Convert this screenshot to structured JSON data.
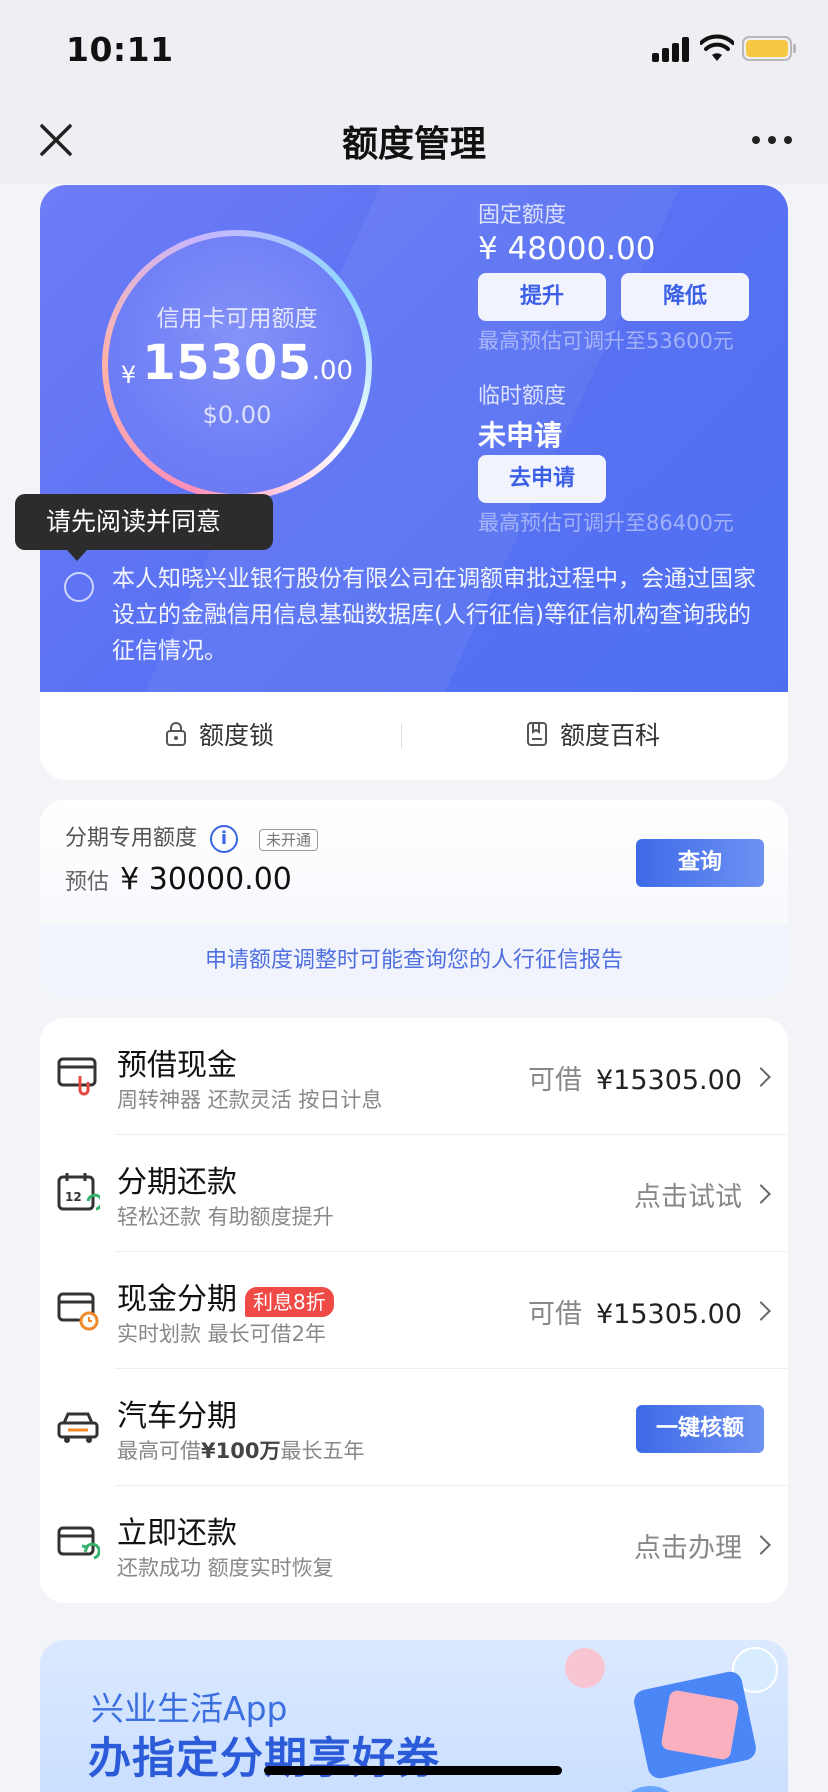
{
  "status_bar": {
    "time": "10:11"
  },
  "nav": {
    "title": "额度管理"
  },
  "hero": {
    "ring_label": "信用卡可用额度",
    "currency": "¥",
    "available_int": "15305",
    "available_dec": ".00",
    "available_secondary": "$0.00",
    "fixed_label": "固定额度",
    "fixed_amount": "¥ 48000.00",
    "raise_btn": "提升",
    "lower_btn": "降低",
    "fixed_hint": "最高预估可调升至53600元",
    "temp_label": "临时额度",
    "temp_status": "未申请",
    "apply_btn": "去申请",
    "temp_hint": "最高预估可调升至86400元",
    "agreement": "本人知晓兴业银行股份有限公司在调额审批过程中，会通过国家设立的金融信用信息基础数据库(人行征信)等征信机构查询我的征信情况。",
    "tooltip": "请先阅读并同意"
  },
  "tabs": [
    {
      "label": "额度锁",
      "icon": "lock-icon"
    },
    {
      "label": "额度百科",
      "icon": "book-icon"
    }
  ],
  "installment": {
    "label": "分期专用额度",
    "status_tag": "未开通",
    "estimate_prefix": "预估",
    "amount": "¥ 30000.00",
    "query_btn": "查询",
    "notice": "申请额度调整时可能查询您的人行征信报告"
  },
  "list": [
    {
      "title": "预借现金",
      "subtitle": "周转神器 还款灵活 按日计息",
      "right_label": "可借",
      "right_value": "¥15305.00",
      "icon": "cash-advance-icon"
    },
    {
      "title": "分期还款",
      "subtitle": "轻松还款 有助额度提升",
      "right_label": "点击试试",
      "icon": "calendar-installment-icon"
    },
    {
      "title": "现金分期",
      "badge": "利息8折",
      "subtitle": "实时划款 最长可借2年",
      "right_label": "可借",
      "right_value": "¥15305.00",
      "icon": "cash-installment-icon"
    },
    {
      "title": "汽车分期",
      "subtitle_pre": "最高可借",
      "subtitle_bold": "¥100万",
      "subtitle_post": "最长五年",
      "button": "一键核额",
      "icon": "car-icon"
    },
    {
      "title": "立即还款",
      "subtitle": "还款成功 额度实时恢复",
      "right_label": "点击办理",
      "icon": "repay-icon"
    }
  ],
  "banner": {
    "line1": "兴业生活App",
    "line2": "办指定分期享好券"
  },
  "colors": {
    "primary": "#5a72f3",
    "accent_blue": "#3d6ae8",
    "badge_red": "#ef4a46"
  }
}
